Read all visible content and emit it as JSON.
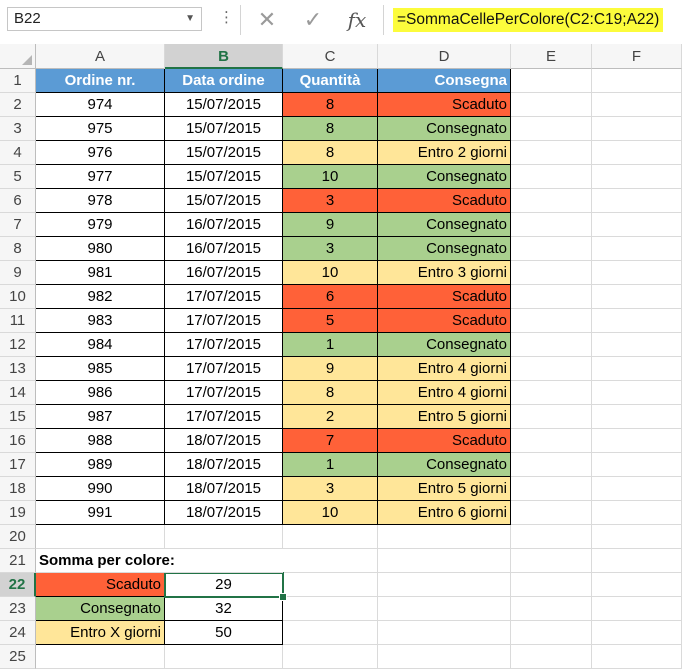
{
  "namebox": {
    "value": "B22"
  },
  "formula_bar": {
    "formula": "=SommaCellePerColore(C2:C19;A22)",
    "fx_label": "fx"
  },
  "columns": [
    "A",
    "B",
    "C",
    "D",
    "E",
    "F"
  ],
  "selected_column": "B",
  "row_numbers": [
    "1",
    "2",
    "3",
    "4",
    "5",
    "6",
    "7",
    "8",
    "9",
    "10",
    "11",
    "12",
    "13",
    "14",
    "15",
    "16",
    "17",
    "18",
    "19",
    "20",
    "21",
    "22",
    "23",
    "24",
    "25"
  ],
  "selected_row": "22",
  "table_headers": [
    "Ordine nr.",
    "Data ordine",
    "Quantità",
    "Consegna"
  ],
  "orders": [
    {
      "ordine": "974",
      "data": "15/07/2015",
      "qta": "8",
      "consegna": "Scaduto",
      "color": "red"
    },
    {
      "ordine": "975",
      "data": "15/07/2015",
      "qta": "8",
      "consegna": "Consegnato",
      "color": "green"
    },
    {
      "ordine": "976",
      "data": "15/07/2015",
      "qta": "8",
      "consegna": "Entro 2 giorni",
      "color": "yellow"
    },
    {
      "ordine": "977",
      "data": "15/07/2015",
      "qta": "10",
      "consegna": "Consegnato",
      "color": "green"
    },
    {
      "ordine": "978",
      "data": "15/07/2015",
      "qta": "3",
      "consegna": "Scaduto",
      "color": "red"
    },
    {
      "ordine": "979",
      "data": "16/07/2015",
      "qta": "9",
      "consegna": "Consegnato",
      "color": "green"
    },
    {
      "ordine": "980",
      "data": "16/07/2015",
      "qta": "3",
      "consegna": "Consegnato",
      "color": "green"
    },
    {
      "ordine": "981",
      "data": "16/07/2015",
      "qta": "10",
      "consegna": "Entro 3 giorni",
      "color": "yellow"
    },
    {
      "ordine": "982",
      "data": "17/07/2015",
      "qta": "6",
      "consegna": "Scaduto",
      "color": "red"
    },
    {
      "ordine": "983",
      "data": "17/07/2015",
      "qta": "5",
      "consegna": "Scaduto",
      "color": "red"
    },
    {
      "ordine": "984",
      "data": "17/07/2015",
      "qta": "1",
      "consegna": "Consegnato",
      "color": "green"
    },
    {
      "ordine": "985",
      "data": "17/07/2015",
      "qta": "9",
      "consegna": "Entro 4 giorni",
      "color": "yellow"
    },
    {
      "ordine": "986",
      "data": "17/07/2015",
      "qta": "8",
      "consegna": "Entro 4 giorni",
      "color": "yellow"
    },
    {
      "ordine": "987",
      "data": "17/07/2015",
      "qta": "2",
      "consegna": "Entro 5 giorni",
      "color": "yellow"
    },
    {
      "ordine": "988",
      "data": "18/07/2015",
      "qta": "7",
      "consegna": "Scaduto",
      "color": "red"
    },
    {
      "ordine": "989",
      "data": "18/07/2015",
      "qta": "1",
      "consegna": "Consegnato",
      "color": "green"
    },
    {
      "ordine": "990",
      "data": "18/07/2015",
      "qta": "3",
      "consegna": "Entro 5 giorni",
      "color": "yellow"
    },
    {
      "ordine": "991",
      "data": "18/07/2015",
      "qta": "10",
      "consegna": "Entro 6 giorni",
      "color": "yellow"
    }
  ],
  "summary": {
    "title": "Somma per colore:",
    "rows": [
      {
        "label": "Scaduto",
        "value": "29",
        "color": "red"
      },
      {
        "label": "Consegnato",
        "value": "32",
        "color": "green"
      },
      {
        "label": "Entro X giorni",
        "value": "50",
        "color": "yellow"
      }
    ]
  },
  "colors": {
    "red": "#ff6138",
    "green": "#a9d08e",
    "yellow": "#ffe699",
    "header": "#5b9bd5",
    "selection": "#217346",
    "formula_highlight": "#fcfc3c"
  }
}
